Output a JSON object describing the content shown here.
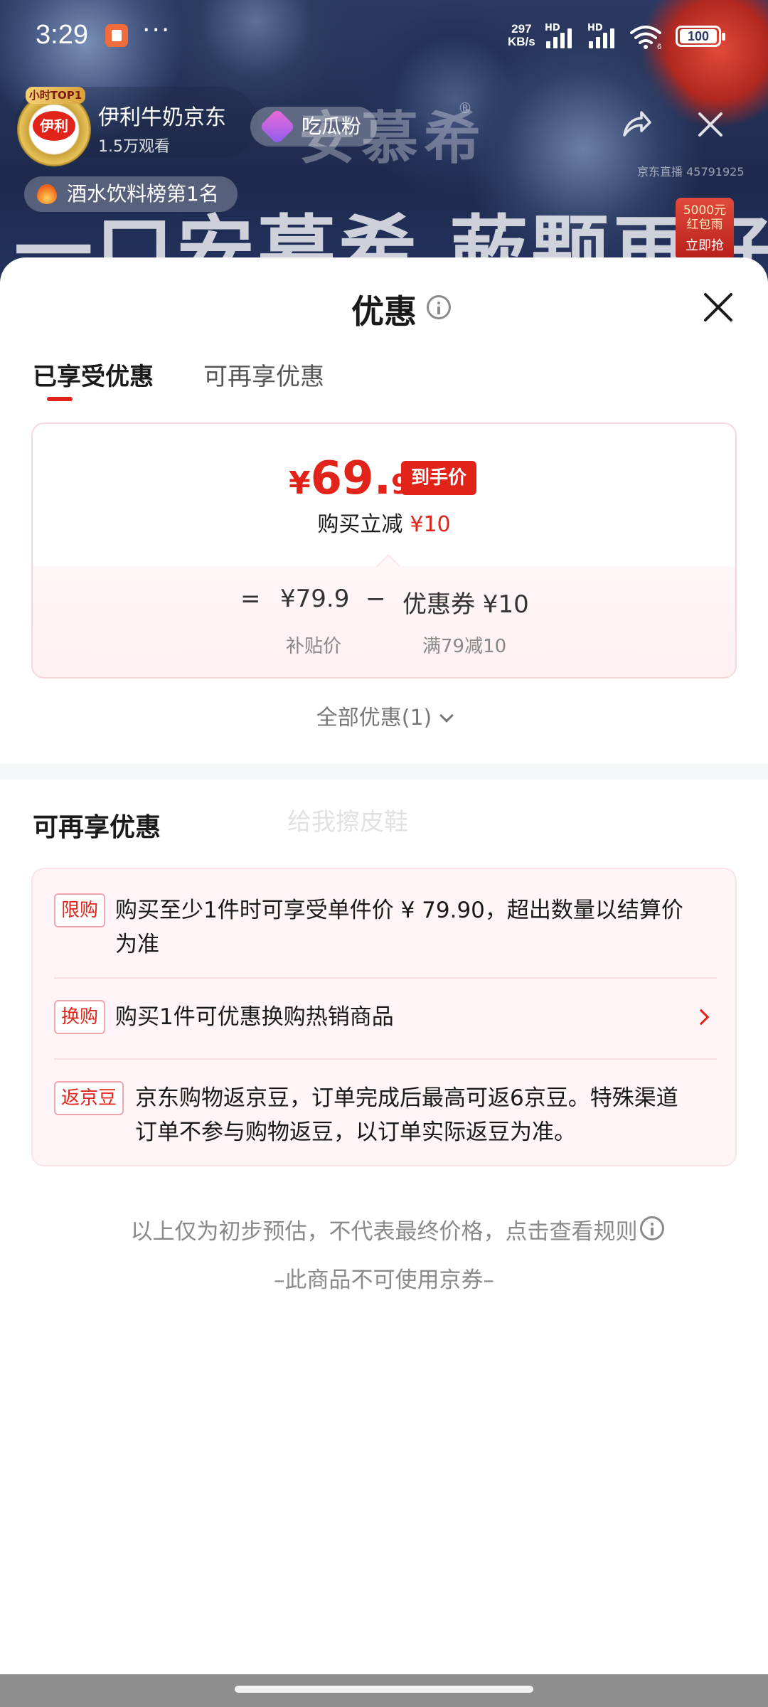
{
  "status_bar": {
    "time": "3:29",
    "net_speed_value": "297",
    "net_speed_unit": "KB/s",
    "sim_label": "HD",
    "wifi_label": "6",
    "battery": "100"
  },
  "live": {
    "top_badge": "小时TOP1",
    "logo_text": "伊利",
    "anchor_name": "伊利牛奶京东",
    "viewers": "1.5万观看",
    "fan_label": "吃瓜粉",
    "brand": "安慕希",
    "brand_reg": "®",
    "slogan": "一口安慕希 蔌颗再好喝",
    "room_id": "京东直播 45791925",
    "rank": "酒水饮料榜第1名",
    "redpack_amount": "5000元",
    "redpack_label": "红包雨",
    "redpack_grab": "立即抢"
  },
  "sheet": {
    "title": "优惠",
    "tabs": [
      {
        "label": "已享受优惠",
        "active": true
      },
      {
        "label": "可再享优惠",
        "active": false
      }
    ],
    "price_card": {
      "currency": "¥",
      "price_int": "69.",
      "price_dec": "9",
      "badge": "到手价",
      "instant_cut_label": "购买立减",
      "instant_cut_amount": "¥10",
      "eq": "=",
      "subsidy_price": "¥79.9",
      "minus": "−",
      "coupon": "优惠券 ¥10",
      "subsidy_label": "补贴价",
      "coupon_rule": "满79减10"
    },
    "all_offers": "全部优惠(1)",
    "more_section_title": "可再享优惠",
    "ghost_text": "给我擦皮鞋",
    "offers": [
      {
        "tag": "限购",
        "text_line1": "购买至少1件时可享受单件价 ¥ 79.90，超出数量以结算价",
        "text_line2": "为准"
      },
      {
        "tag": "换购",
        "text_line1": "购买1件可优惠换购热销商品"
      },
      {
        "tag": "返京豆",
        "text_line1": "京东购物返京豆，订单完成后最高可返6京豆。特殊渠道",
        "text_line2": "订单不参与购物返豆，以订单实际返豆为准。"
      }
    ],
    "footer_note": "以上仅为初步预估，不代表最终价格，点击查看规则",
    "footer_note2": "–此商品不可使用京券–"
  },
  "colors": {
    "accent": "#e2231a",
    "sheet_bg": "#ffffff",
    "offers_bg": "#fff5f6"
  }
}
